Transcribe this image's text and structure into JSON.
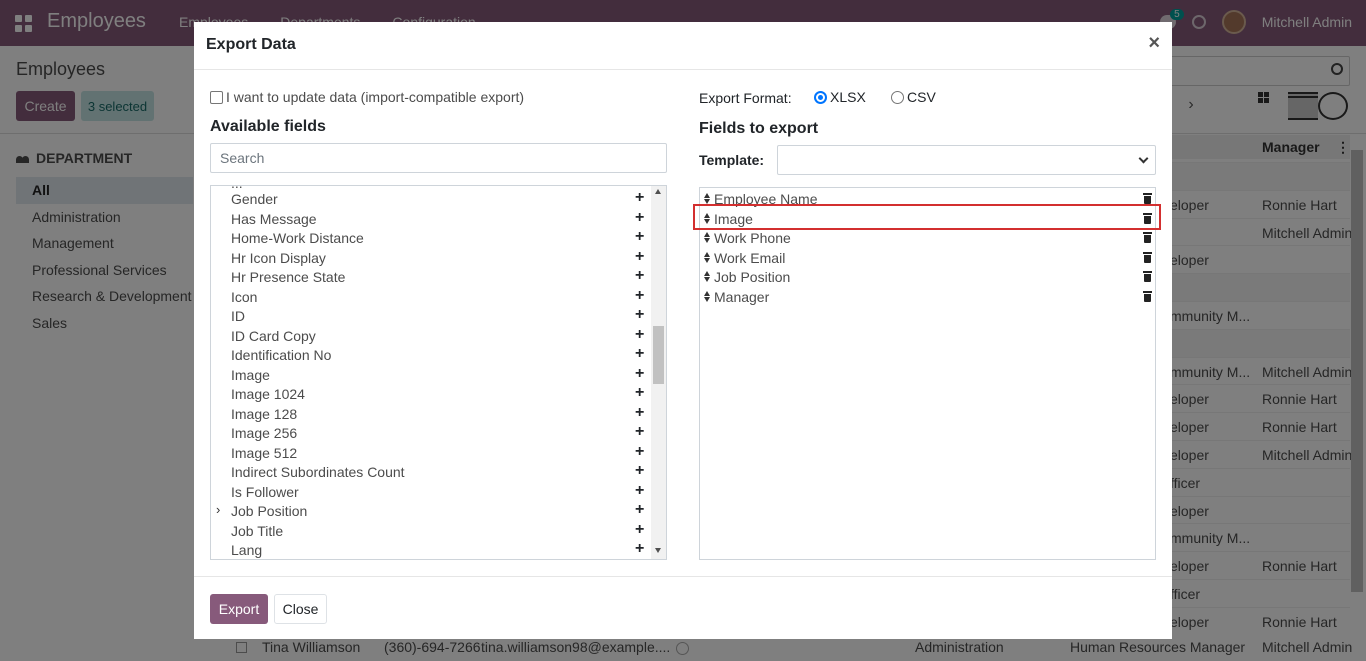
{
  "app": {
    "name": "Employees",
    "menu": [
      "Employees",
      "Departments",
      "Configuration"
    ],
    "chat_badge": "5",
    "user": "Mitchell Admin"
  },
  "control": {
    "breadcrumb": "Employees",
    "create_label": "Create",
    "selected_label": "3 selected"
  },
  "sidebar": {
    "title": "DEPARTMENT",
    "items": [
      {
        "label": "All"
      },
      {
        "label": "Administration"
      },
      {
        "label": "Management"
      },
      {
        "label": "Professional Services"
      },
      {
        "label": "Research & Development"
      },
      {
        "label": "Sales"
      }
    ]
  },
  "list": {
    "manager_header": "Manager",
    "rows": [
      {
        "job": "",
        "mgr": ""
      },
      {
        "job": "eloper",
        "mgr": "Ronnie Hart"
      },
      {
        "job": "",
        "mgr": "Mitchell Admin"
      },
      {
        "job": "eloper",
        "mgr": ""
      },
      {
        "job": "",
        "mgr": ""
      },
      {
        "job": "mmunity M...",
        "mgr": ""
      },
      {
        "job": "",
        "mgr": ""
      },
      {
        "job": "mmunity M...",
        "mgr": "Mitchell Admin"
      },
      {
        "job": "eloper",
        "mgr": "Ronnie Hart"
      },
      {
        "job": "eloper",
        "mgr": "Ronnie Hart"
      },
      {
        "job": "eloper",
        "mgr": "Mitchell Admin"
      },
      {
        "job": "fficer",
        "mgr": ""
      },
      {
        "job": "eloper",
        "mgr": ""
      },
      {
        "job": "mmunity M...",
        "mgr": ""
      },
      {
        "job": "eloper",
        "mgr": "Ronnie Hart"
      },
      {
        "job": "fficer",
        "mgr": ""
      },
      {
        "job": "eloper",
        "mgr": "Ronnie Hart"
      }
    ],
    "last_row": {
      "name": "Tina Williamson",
      "phone": "(360)-694-7266",
      "email": "tina.williamson98@example....",
      "department": "Administration",
      "job": "Human Resources Manager",
      "manager": "Mitchell Admin"
    }
  },
  "dialog": {
    "title": "Export Data",
    "close_symbol": "×",
    "import_compat_label": "I want to update data (import-compatible export)",
    "available_title": "Available fields",
    "search_placeholder": "Search",
    "cut_top_item": "...",
    "available_fields": [
      {
        "label": "Gender",
        "expandable": false
      },
      {
        "label": "Has Message",
        "expandable": false
      },
      {
        "label": "Home-Work Distance",
        "expandable": false
      },
      {
        "label": "Hr Icon Display",
        "expandable": false
      },
      {
        "label": "Hr Presence State",
        "expandable": false
      },
      {
        "label": "Icon",
        "expandable": false
      },
      {
        "label": "ID",
        "expandable": false
      },
      {
        "label": "ID Card Copy",
        "expandable": false
      },
      {
        "label": "Identification No",
        "expandable": false
      },
      {
        "label": "Image",
        "expandable": false
      },
      {
        "label": "Image 1024",
        "expandable": false
      },
      {
        "label": "Image 128",
        "expandable": false
      },
      {
        "label": "Image 256",
        "expandable": false
      },
      {
        "label": "Image 512",
        "expandable": false
      },
      {
        "label": "Indirect Subordinates Count",
        "expandable": false
      },
      {
        "label": "Is Follower",
        "expandable": false
      },
      {
        "label": "Job Position",
        "expandable": true
      },
      {
        "label": "Job Title",
        "expandable": false
      },
      {
        "label": "Lang",
        "expandable": false
      }
    ],
    "format_label": "Export Format:",
    "formats": [
      {
        "label": "XLSX",
        "checked": true
      },
      {
        "label": "CSV",
        "checked": false
      }
    ],
    "export_title": "Fields to export",
    "template_label": "Template:",
    "template_value": "",
    "export_fields": [
      {
        "label": "Employee Name"
      },
      {
        "label": "Image"
      },
      {
        "label": "Work Phone"
      },
      {
        "label": "Work Email"
      },
      {
        "label": "Job Position"
      },
      {
        "label": "Manager"
      }
    ],
    "export_button": "Export",
    "close_button": "Close"
  },
  "colors": {
    "brand": "#875a7b",
    "highlight": "#d32f2f",
    "radio_accent": "#0075ff"
  }
}
